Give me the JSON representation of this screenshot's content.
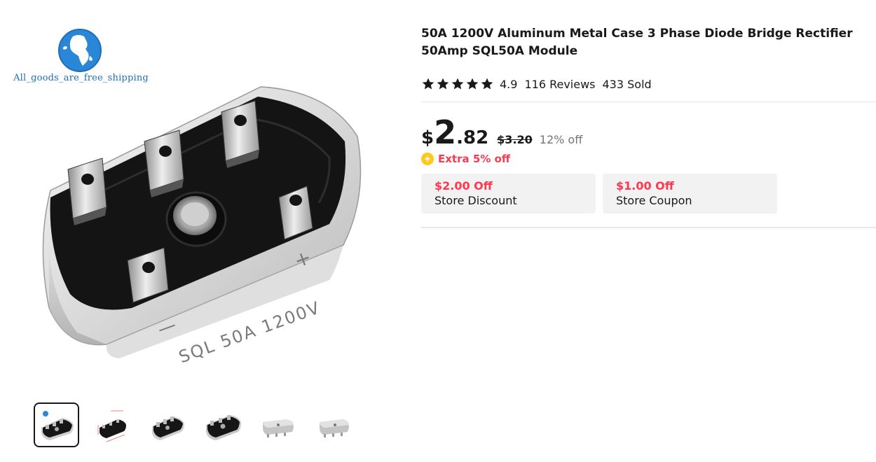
{
  "store": {
    "logo_text": "All_goods_are_free_shipping"
  },
  "gallery": {
    "main_image": {
      "markings": {
        "minus": "—",
        "plus": "+",
        "print": "SQL 50A 1200V"
      }
    },
    "thumbnails": [
      {
        "id": "t1",
        "active": true
      },
      {
        "id": "t2",
        "active": false
      },
      {
        "id": "t3",
        "active": false
      },
      {
        "id": "t4",
        "active": false
      },
      {
        "id": "t5",
        "active": false
      },
      {
        "id": "t6",
        "active": false
      }
    ]
  },
  "product": {
    "title": "50A 1200V Aluminum Metal Case 3 Phase Diode Bridge Rectifier 50Amp SQL50A Module",
    "rating": {
      "stars": 5,
      "value": "4.9",
      "reviews": "116 Reviews",
      "sold": "433 Sold"
    },
    "price": {
      "currency": "$",
      "integer": "2",
      "decimal": ".82",
      "original": "$3.20",
      "discount": "12% off"
    },
    "extra_offer": "Extra 5% off",
    "coupons": [
      {
        "amount": "$2.00 Off",
        "label": "Store Discount"
      },
      {
        "amount": "$1.00 Off",
        "label": "Store Coupon"
      }
    ]
  },
  "colors": {
    "accent_red": "#fd384f",
    "text": "#191919",
    "muted": "#757575",
    "coupon_bg": "#f2f2f2",
    "badge_yellow": "#ffc81a",
    "logo_blue": "#1f6fb5"
  }
}
